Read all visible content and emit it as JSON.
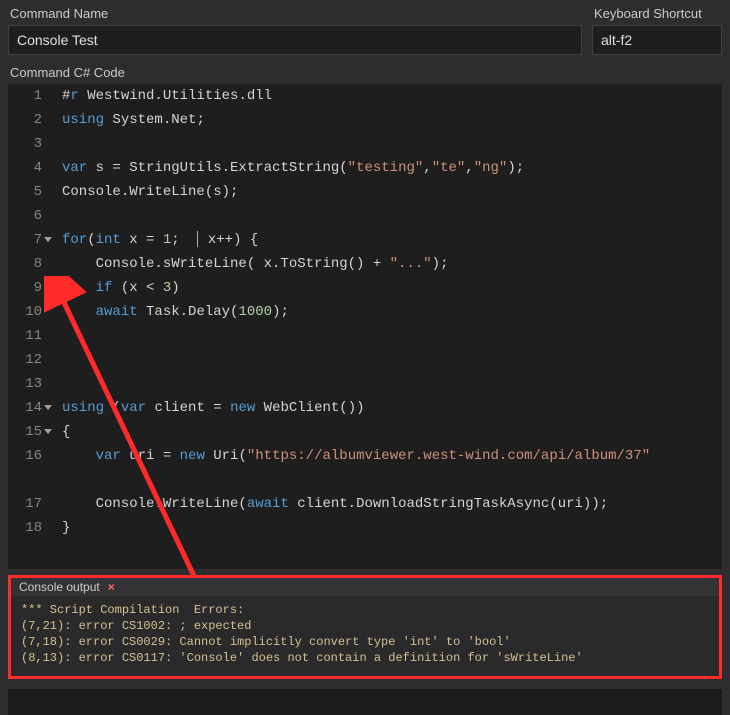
{
  "labels": {
    "command_name": "Command Name",
    "keyboard_shortcut": "Keyboard Shortcut",
    "code": "Command C# Code",
    "console_title": "Console output"
  },
  "inputs": {
    "command_name_value": "Console Test",
    "keyboard_shortcut_value": "alt-f2"
  },
  "code": {
    "lines": [
      {
        "n": 1,
        "fold": false,
        "tokens": [
          [
            "punc",
            "#"
          ],
          [
            "kw",
            "r"
          ],
          [
            "punc",
            " Westwind.Utilities.dll"
          ]
        ]
      },
      {
        "n": 2,
        "fold": false,
        "tokens": [
          [
            "kw",
            "using "
          ],
          [
            "cls",
            "System.Net"
          ],
          [
            "punc",
            ";"
          ]
        ]
      },
      {
        "n": 3,
        "fold": false,
        "tokens": [
          [
            "punc",
            ""
          ]
        ]
      },
      {
        "n": 4,
        "fold": false,
        "tokens": [
          [
            "kw",
            "var "
          ],
          [
            "punc",
            "s = StringUtils.ExtractString("
          ],
          [
            "str",
            "\"testing\""
          ],
          [
            "punc",
            ","
          ],
          [
            "str",
            "\"te\""
          ],
          [
            "punc",
            ","
          ],
          [
            "str",
            "\"ng\""
          ],
          [
            "punc",
            ");"
          ]
        ]
      },
      {
        "n": 5,
        "fold": false,
        "tokens": [
          [
            "cls",
            "Console"
          ],
          [
            "punc",
            ".WriteLine(s);"
          ]
        ]
      },
      {
        "n": 6,
        "fold": false,
        "tokens": [
          [
            "punc",
            ""
          ]
        ]
      },
      {
        "n": 7,
        "fold": true,
        "tokens": [
          [
            "kw",
            "for"
          ],
          [
            "punc",
            "("
          ],
          [
            "kw",
            "int "
          ],
          [
            "punc",
            "x = "
          ],
          [
            "num",
            "1"
          ],
          [
            "punc",
            ";  "
          ],
          [
            "cursor",
            ""
          ],
          [
            "punc",
            " x++) {"
          ]
        ]
      },
      {
        "n": 8,
        "fold": false,
        "tokens": [
          [
            "punc",
            "    Console.sWriteLine( x.ToString() + "
          ],
          [
            "str",
            "\"...\""
          ],
          [
            "punc",
            ");"
          ]
        ]
      },
      {
        "n": 9,
        "fold": false,
        "tokens": [
          [
            "punc",
            "    "
          ],
          [
            "kw",
            "if "
          ],
          [
            "punc",
            "(x < "
          ],
          [
            "num",
            "3"
          ],
          [
            "punc",
            ")"
          ]
        ]
      },
      {
        "n": 10,
        "fold": false,
        "tokens": [
          [
            "punc",
            "    "
          ],
          [
            "kw",
            "await "
          ],
          [
            "cls",
            "Task"
          ],
          [
            "punc",
            ".Delay("
          ],
          [
            "num",
            "1000"
          ],
          [
            "punc",
            ");"
          ]
        ]
      },
      {
        "n": 11,
        "fold": false,
        "tokens": [
          [
            "punc",
            ""
          ]
        ]
      },
      {
        "n": 12,
        "fold": false,
        "tokens": [
          [
            "punc",
            ""
          ]
        ]
      },
      {
        "n": 13,
        "fold": false,
        "tokens": [
          [
            "punc",
            ""
          ]
        ]
      },
      {
        "n": 14,
        "fold": true,
        "tokens": [
          [
            "kw",
            "using "
          ],
          [
            "punc",
            "("
          ],
          [
            "kw",
            "var "
          ],
          [
            "punc",
            "client = "
          ],
          [
            "kw",
            "new "
          ],
          [
            "cls",
            "WebClient"
          ],
          [
            "punc",
            "())"
          ]
        ]
      },
      {
        "n": 15,
        "fold": true,
        "tokens": [
          [
            "punc",
            "{"
          ]
        ]
      },
      {
        "n": 16,
        "fold": false,
        "tokens": [
          [
            "punc",
            "    "
          ],
          [
            "kw",
            "var "
          ],
          [
            "punc",
            "uri = "
          ],
          [
            "kw",
            "new "
          ],
          [
            "cls",
            "Uri"
          ],
          [
            "punc",
            "("
          ],
          [
            "str",
            "\"https://albumviewer.west-wind.com/api/album/37\""
          ]
        ]
      },
      {
        "n": "",
        "fold": false,
        "tokens": [
          [
            "punc",
            ""
          ]
        ]
      },
      {
        "n": 17,
        "fold": false,
        "tokens": [
          [
            "punc",
            "    Console.WriteLine("
          ],
          [
            "kw",
            "await "
          ],
          [
            "punc",
            "client.DownloadStringTaskAsync(uri));"
          ]
        ]
      },
      {
        "n": 18,
        "fold": false,
        "tokens": [
          [
            "punc",
            "}"
          ]
        ]
      }
    ]
  },
  "console": {
    "lines": [
      "*** Script Compilation  Errors:",
      "(7,21): error CS1002: ; expected",
      "(7,18): error CS0029: Cannot implicitly convert type 'int' to 'bool'",
      "(8,13): error CS0117: 'Console' does not contain a definition for 'sWriteLine'"
    ]
  },
  "colors": {
    "annotation_red": "#ff2b2b"
  }
}
